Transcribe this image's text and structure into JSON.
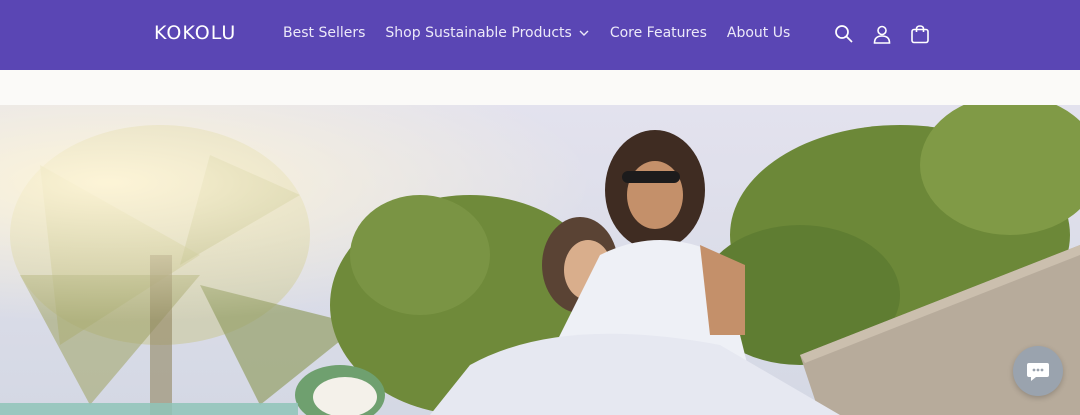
{
  "header": {
    "logo": "KOKOLU",
    "nav": [
      {
        "label": "Best Sellers"
      },
      {
        "label": "Shop Sustainable Products",
        "has_dropdown": true
      },
      {
        "label": "Core Features"
      },
      {
        "label": "About Us"
      }
    ],
    "icons": [
      "search-icon",
      "account-icon",
      "cart-icon"
    ],
    "background_color": "#5a46b4"
  },
  "hero": {
    "image_description": "",
    "colors": {
      "sky": "#d9d6e8",
      "foliage": "#6f8a3a",
      "dress": "#e9ecf4"
    }
  },
  "chat_widget": {
    "icon": "chat-icon"
  },
  "bottom_overlay": {
    "text": ""
  }
}
